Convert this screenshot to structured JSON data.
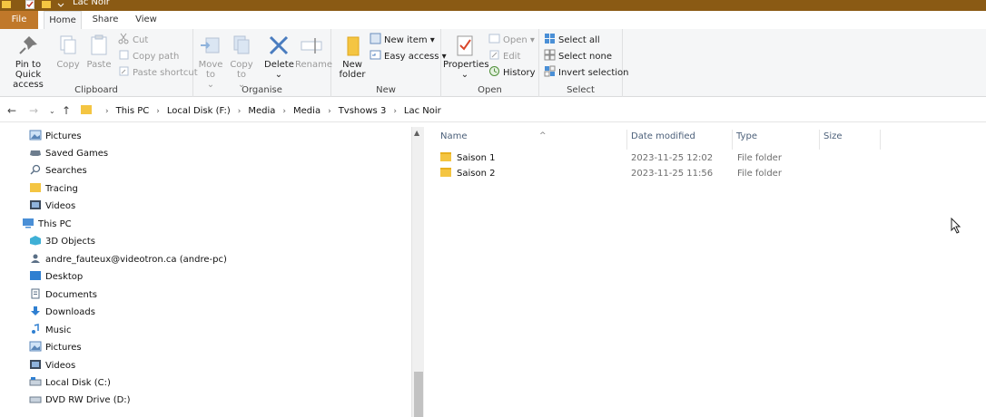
{
  "window": {
    "title": "Lac Noir"
  },
  "tabs": [
    "File",
    "Home",
    "Share",
    "View"
  ],
  "ribbon": {
    "clipboard": {
      "label": "Clipboard",
      "pin": "Pin to Quick access",
      "copy": "Copy",
      "paste": "Paste",
      "cut": "Cut",
      "copy_path": "Copy path",
      "paste_shortcut": "Paste shortcut"
    },
    "organise": {
      "label": "Organise",
      "move_to": "Move to",
      "copy_to": "Copy to",
      "delete": "Delete",
      "rename": "Rename"
    },
    "new": {
      "label": "New",
      "new_folder": "New folder",
      "new_item": "New item",
      "easy_access": "Easy access"
    },
    "open": {
      "label": "Open",
      "properties": "Properties",
      "open": "Open",
      "edit": "Edit",
      "history": "History"
    },
    "select": {
      "label": "Select",
      "select_all": "Select all",
      "select_none": "Select none",
      "invert": "Invert selection"
    }
  },
  "breadcrumb": [
    "This PC",
    "Local Disk (F:)",
    "Media",
    "Media",
    "Tvshows 3",
    "Lac Noir"
  ],
  "nav_pane": [
    {
      "label": "Pictures",
      "icon": "pictures-icon",
      "indent": 1
    },
    {
      "label": "Saved Games",
      "icon": "saved-games-icon",
      "indent": 1
    },
    {
      "label": "Searches",
      "icon": "search-icon",
      "indent": 1
    },
    {
      "label": "Tracing",
      "icon": "folder-icon",
      "indent": 1
    },
    {
      "label": "Videos",
      "icon": "videos-icon",
      "indent": 1
    },
    {
      "label": "This PC",
      "icon": "this-pc-icon",
      "indent": 0
    },
    {
      "label": "3D Objects",
      "icon": "3d-objects-icon",
      "indent": 1
    },
    {
      "label": "andre_fauteux@videotron.ca (andre-pc)",
      "icon": "network-user-icon",
      "indent": 1
    },
    {
      "label": "Desktop",
      "icon": "desktop-icon",
      "indent": 1
    },
    {
      "label": "Documents",
      "icon": "documents-icon",
      "indent": 1
    },
    {
      "label": "Downloads",
      "icon": "downloads-icon",
      "indent": 1
    },
    {
      "label": "Music",
      "icon": "music-icon",
      "indent": 1
    },
    {
      "label": "Pictures",
      "icon": "pictures-icon",
      "indent": 1
    },
    {
      "label": "Videos",
      "icon": "videos-icon",
      "indent": 1
    },
    {
      "label": "Local Disk (C:)",
      "icon": "drive-icon",
      "indent": 1
    },
    {
      "label": "DVD RW Drive (D:)",
      "icon": "dvd-drive-icon",
      "indent": 1
    }
  ],
  "columns": {
    "name": "Name",
    "date": "Date modified",
    "type": "Type",
    "size": "Size"
  },
  "files": [
    {
      "name": "Saison 1",
      "date": "2023-11-25 12:02",
      "type": "File folder"
    },
    {
      "name": "Saison 2",
      "date": "2023-11-25 11:56",
      "type": "File folder"
    }
  ],
  "colors": {
    "accent": "#c0782a",
    "titlebar": "#8a5a14",
    "folder": "#f4c542",
    "header_text": "#4c607a"
  }
}
